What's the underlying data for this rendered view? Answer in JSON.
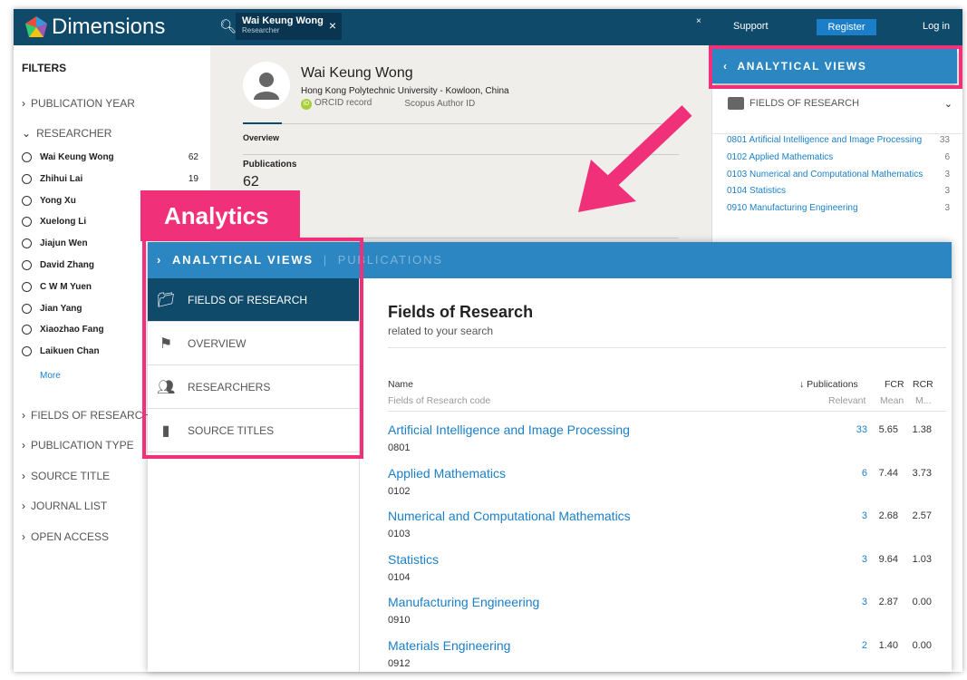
{
  "header": {
    "brand": "Dimensions",
    "search_chip": {
      "name": "Wai Keung Wong",
      "type": "Researcher"
    },
    "clear": "×",
    "support": "Support",
    "register": "Register",
    "login": "Log in"
  },
  "filters": {
    "title": "FILTERS",
    "publication_year": "PUBLICATION YEAR",
    "researcher": "RESEARCHER",
    "researchers": [
      {
        "name": "Wai Keung Wong",
        "count": "62"
      },
      {
        "name": "Zhihui Lai",
        "count": "19"
      },
      {
        "name": "Yong Xu",
        "count": ""
      },
      {
        "name": "Xuelong Li",
        "count": ""
      },
      {
        "name": "Jiajun Wen",
        "count": ""
      },
      {
        "name": "David Zhang",
        "count": ""
      },
      {
        "name": "C W M Yuen",
        "count": ""
      },
      {
        "name": "Jian Yang",
        "count": ""
      },
      {
        "name": "Xiaozhao Fang",
        "count": ""
      },
      {
        "name": "Laikuen Chan",
        "count": ""
      }
    ],
    "more": "More",
    "fields_of_research": "FIELDS OF RESEARCH",
    "publication_type": "PUBLICATION TYPE",
    "source_title": "SOURCE TITLE",
    "journal_list": "JOURNAL LIST",
    "open_access": "OPEN ACCESS"
  },
  "profile": {
    "name": "Wai Keung Wong",
    "affiliation": "Hong Kong Polytechnic University - Kowloon, China",
    "orcid": "ORCID record",
    "scopus": "Scopus Author ID",
    "tab": "Overview",
    "publications_label": "Publications",
    "publications_count": "62"
  },
  "right_panel": {
    "title": "ANALYTICAL VIEWS",
    "section": "FIELDS OF RESEARCH",
    "items": [
      {
        "label": "0801 Artificial Intelligence and Image Processing",
        "count": "33"
      },
      {
        "label": "0102 Applied Mathematics",
        "count": "6"
      },
      {
        "label": "0103 Numerical and Computational Mathematics",
        "count": "3"
      },
      {
        "label": "0104 Statistics",
        "count": "3"
      },
      {
        "label": "0910 Manufacturing Engineering",
        "count": "3"
      }
    ]
  },
  "callout": "Analytics",
  "overlay": {
    "bar_title": "ANALYTICAL VIEWS",
    "bar_sep": "|",
    "bar_pubs": "PUBLICATIONS",
    "nav": [
      {
        "label": "FIELDS OF RESEARCH",
        "icon": "folder-icon"
      },
      {
        "label": "OVERVIEW",
        "icon": "flag-icon"
      },
      {
        "label": "RESEARCHERS",
        "icon": "people-icon"
      },
      {
        "label": "SOURCE TITLES",
        "icon": "book-icon"
      }
    ],
    "title": "Fields of Research",
    "subtitle": "related to your search",
    "columns": {
      "name": "Name",
      "code": "Fields of Research code",
      "pubs": "↓ Publications",
      "pubs_sub": "Relevant",
      "fcr": "FCR",
      "fcr_sub": "Mean",
      "rcr": "RCR",
      "rcr_sub": "M..."
    },
    "rows": [
      {
        "name": "Artificial Intelligence and Image Processing",
        "code": "0801",
        "pubs": "33",
        "fcr": "5.65",
        "rcr": "1.38"
      },
      {
        "name": "Applied Mathematics",
        "code": "0102",
        "pubs": "6",
        "fcr": "7.44",
        "rcr": "3.73"
      },
      {
        "name": "Numerical and Computational Mathematics",
        "code": "0103",
        "pubs": "3",
        "fcr": "2.68",
        "rcr": "2.57"
      },
      {
        "name": "Statistics",
        "code": "0104",
        "pubs": "3",
        "fcr": "9.64",
        "rcr": "1.03"
      },
      {
        "name": "Manufacturing Engineering",
        "code": "0910",
        "pubs": "3",
        "fcr": "2.87",
        "rcr": "0.00"
      },
      {
        "name": "Materials Engineering",
        "code": "0912",
        "pubs": "2",
        "fcr": "1.40",
        "rcr": "0.00"
      }
    ]
  },
  "colors": {
    "header": "#0f4a6b",
    "accent": "#2c86c1",
    "link": "#1a7fc8",
    "highlight": "#f0317a"
  }
}
